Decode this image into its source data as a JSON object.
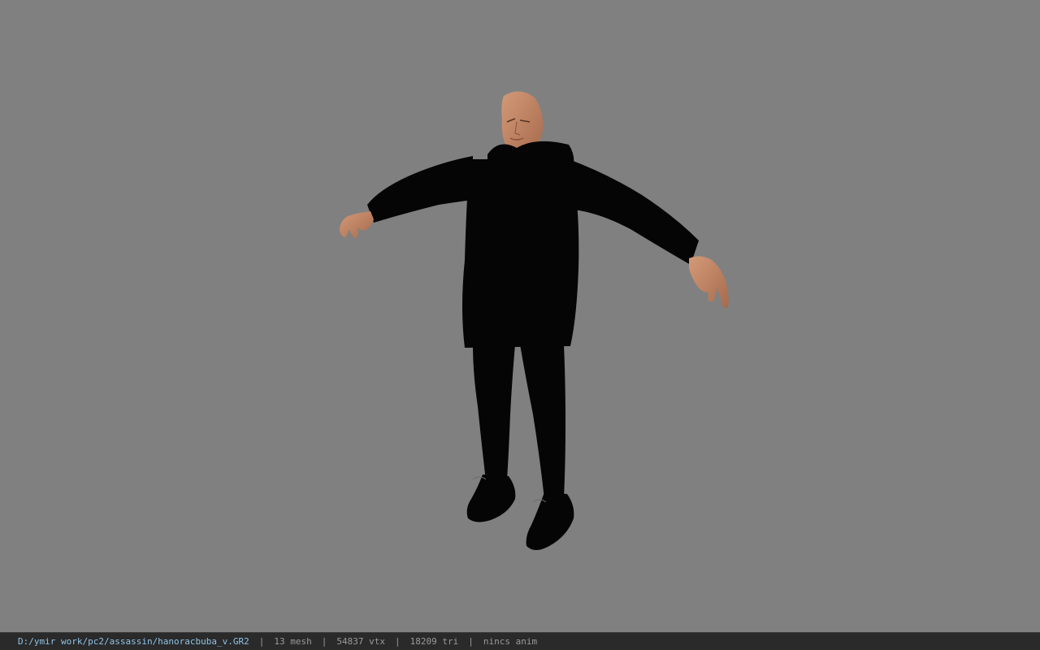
{
  "viewport": {
    "background_color": "#808080",
    "model": {
      "label": "character-model",
      "skin_color": "#c08a6a",
      "clothing_color": "#050505"
    }
  },
  "statusbar": {
    "file_path": "D:/ymir work/pc2/assassin/hanoracbuba_v.GR2",
    "separator": "|",
    "mesh_count": "13 mesh",
    "vertex_count": "54837 vtx",
    "triangle_count": "18209 tri",
    "animation": "nincs anim",
    "path_color": "#8fc3e8",
    "text_color": "#9a9a9a"
  }
}
